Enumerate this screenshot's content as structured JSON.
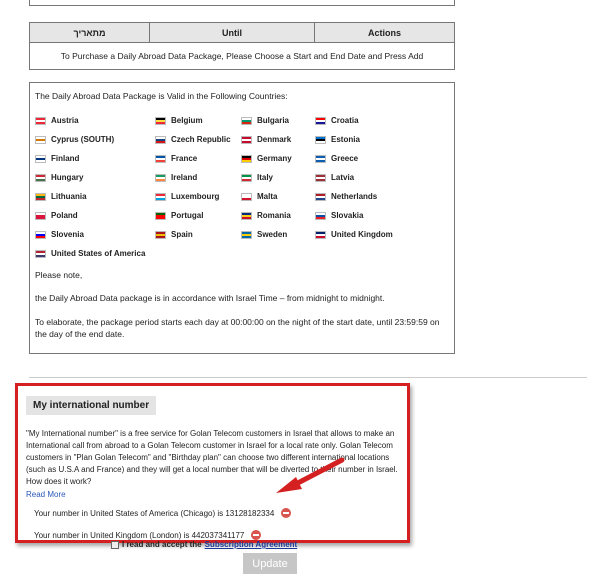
{
  "table": {
    "headers": [
      "מתאריך",
      "Until",
      "Actions"
    ],
    "message": "To Purchase a Daily Abroad Data Package, Please Choose a Start and End Date and Press Add"
  },
  "countries_section": {
    "title": "The Daily Abroad Data Package is Valid in the Following Countries:",
    "countries": [
      {
        "name": "Austria",
        "flag_colors": [
          "#ed2939",
          "#ffffff",
          "#ed2939"
        ]
      },
      {
        "name": "Belgium",
        "flag_colors": [
          "#000000",
          "#fae042",
          "#ed2939"
        ]
      },
      {
        "name": "Bulgaria",
        "flag_colors": [
          "#ffffff",
          "#00966e",
          "#d62612"
        ]
      },
      {
        "name": "Croatia",
        "flag_colors": [
          "#ff0000",
          "#ffffff",
          "#171796"
        ]
      },
      {
        "name": "Cyprus (SOUTH)",
        "flag_colors": [
          "#ffffff",
          "#d57800",
          "#ffffff"
        ]
      },
      {
        "name": "Czech Republic",
        "flag_colors": [
          "#ffffff",
          "#11457e",
          "#d7141a"
        ]
      },
      {
        "name": "Denmark",
        "flag_colors": [
          "#c60c30",
          "#ffffff",
          "#c60c30"
        ]
      },
      {
        "name": "Estonia",
        "flag_colors": [
          "#0072ce",
          "#000000",
          "#ffffff"
        ]
      },
      {
        "name": "Finland",
        "flag_colors": [
          "#ffffff",
          "#003580",
          "#ffffff"
        ]
      },
      {
        "name": "France",
        "flag_colors": [
          "#0055a4",
          "#ffffff",
          "#ef4135"
        ]
      },
      {
        "name": "Germany",
        "flag_colors": [
          "#000000",
          "#dd0000",
          "#ffce00"
        ]
      },
      {
        "name": "Greece",
        "flag_colors": [
          "#0d5eaf",
          "#ffffff",
          "#0d5eaf"
        ]
      },
      {
        "name": "Hungary",
        "flag_colors": [
          "#ce2939",
          "#ffffff",
          "#477050"
        ]
      },
      {
        "name": "Ireland",
        "flag_colors": [
          "#169b62",
          "#ffffff",
          "#ff883e"
        ]
      },
      {
        "name": "Italy",
        "flag_colors": [
          "#009246",
          "#ffffff",
          "#ce2b37"
        ]
      },
      {
        "name": "Latvia",
        "flag_colors": [
          "#9e3039",
          "#ffffff",
          "#9e3039"
        ]
      },
      {
        "name": "Lithuania",
        "flag_colors": [
          "#fdb913",
          "#006a44",
          "#c1272d"
        ]
      },
      {
        "name": "Luxembourg",
        "flag_colors": [
          "#ed2939",
          "#ffffff",
          "#00a1de"
        ]
      },
      {
        "name": "Malta",
        "flag_colors": [
          "#ffffff",
          "#ffffff",
          "#cf142b"
        ]
      },
      {
        "name": "Netherlands",
        "flag_colors": [
          "#ae1c28",
          "#ffffff",
          "#21468b"
        ]
      },
      {
        "name": "Poland",
        "flag_colors": [
          "#ffffff",
          "#dc143c",
          "#dc143c"
        ]
      },
      {
        "name": "Portugal",
        "flag_colors": [
          "#006600",
          "#ff0000",
          "#ff0000"
        ]
      },
      {
        "name": "Romania",
        "flag_colors": [
          "#002b7f",
          "#fcd116",
          "#ce1126"
        ]
      },
      {
        "name": "Slovakia",
        "flag_colors": [
          "#ffffff",
          "#0b4ea2",
          "#ee1c25"
        ]
      },
      {
        "name": "Slovenia",
        "flag_colors": [
          "#ffffff",
          "#0000ff",
          "#ff0000"
        ]
      },
      {
        "name": "Spain",
        "flag_colors": [
          "#aa151b",
          "#f1bf00",
          "#aa151b"
        ]
      },
      {
        "name": "Sweden",
        "flag_colors": [
          "#006aa7",
          "#fecc00",
          "#006aa7"
        ]
      },
      {
        "name": "United Kingdom",
        "flag_colors": [
          "#012169",
          "#ffffff",
          "#c8102e"
        ]
      },
      {
        "name": "United States of America",
        "flag_colors": [
          "#b22234",
          "#ffffff",
          "#3c3b6e"
        ]
      }
    ],
    "notes": [
      "Please note,",
      "the Daily Abroad Data package is in accordance with Israel Time – from midnight to midnight.",
      "To elaborate, the package period starts each day at 00:00:00 on the night of the start date, until 23:59:59 on the day of the end date."
    ]
  },
  "international": {
    "title": "My international number",
    "description": "\"My International number\" is a free service for Golan Telecom customers in Israel that allows to make an International call from abroad to a Golan Telecom customer in Israel for a local rate only.  Golan Telecom customers in \"Plan Golan Telecom\" and \"Birthday plan\" can choose two different international locations (such as U.S.A and France) and they will get a local number that will be diverted to their number in Israel.",
    "question": "How does it work?",
    "read_more": "Read More",
    "numbers": [
      "Your number in United States of America (Chicago) is 13128182334",
      "Your number in United Kingdom (London) is 442037341177"
    ]
  },
  "agreement": {
    "text": "I read and accept the",
    "link": "Subscription Agreement"
  },
  "update_label": "Update",
  "colors": {
    "highlight_border": "#d42020",
    "link": "#2a58b8",
    "remove_icon": "#d9534f"
  }
}
